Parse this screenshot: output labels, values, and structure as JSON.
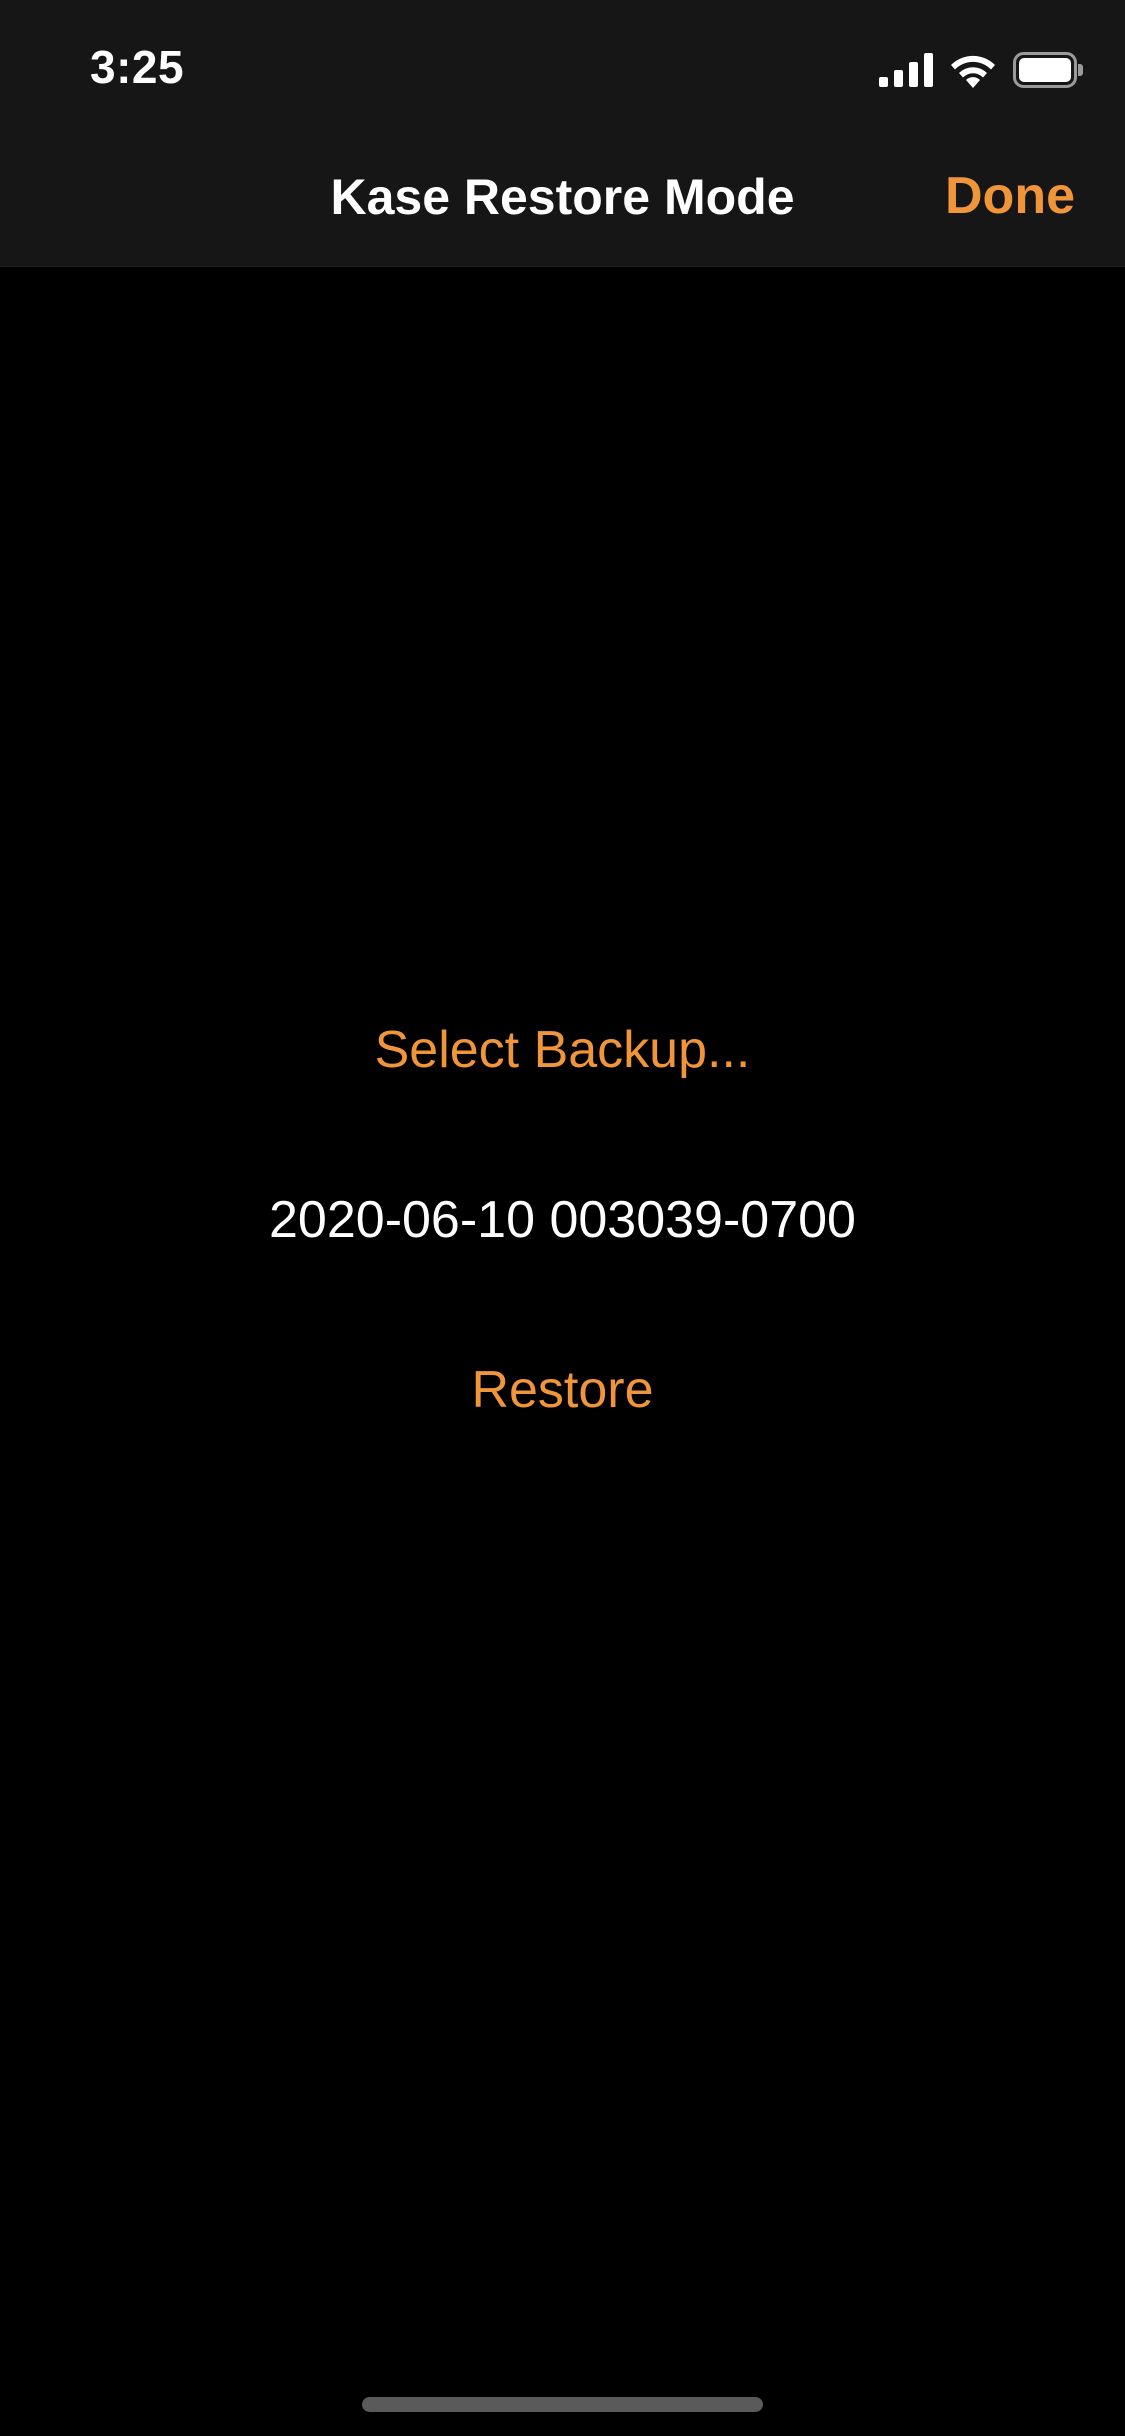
{
  "status_bar": {
    "time": "3:25",
    "icons": [
      "signal-icon",
      "wifi-icon",
      "battery-icon"
    ]
  },
  "nav": {
    "title": "Kase Restore Mode",
    "done_label": "Done"
  },
  "main": {
    "select_backup_label": "Select Backup...",
    "backup_name": "2020-06-10 003039-0700",
    "restore_label": "Restore"
  },
  "colors": {
    "accent": "#f0953a",
    "background": "#000000",
    "bar_background": "#161616",
    "text": "#ffffff"
  }
}
